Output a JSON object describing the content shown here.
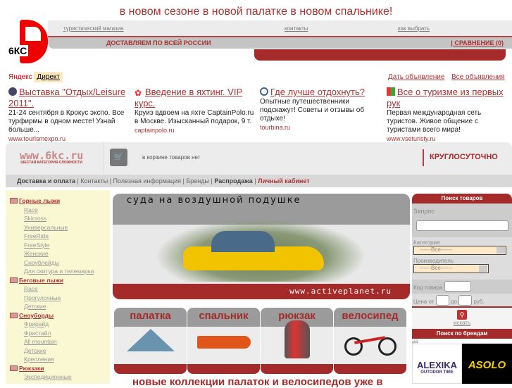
{
  "tagline": "в новом сезоне в новой палатке в новом спальнике!",
  "logo_text": "6КС",
  "topnav": [
    "туристический магазин",
    "контакты",
    "как выбрать"
  ],
  "delivery": "ДОСТАВЛЯЕМ ПО ВСЕЙ РОССИИ",
  "compare": "| СРАВНЕНИЕ (0)",
  "yandex": {
    "brand": "Яндекс",
    "direct": "Директ",
    "give_ad": "Дать объявление",
    "all_ads": "Все объявления"
  },
  "ads": [
    {
      "title": "Выставка \"Отдых/Leisure 2011\".",
      "text": "21-24 сентября в Крокус экспо. Все турфирмы в одном месте! Узнай больше...",
      "url": "www.tourismexpo.ru"
    },
    {
      "title": "Введение в яхтинг. VIP курс.",
      "text": "Круиз вдвоем на яхте CaptainPolo.ru в Москве. Изысканный подарок, 9 т.",
      "url": "captainpolo.ru"
    },
    {
      "title": "Где лучше отдохнуть?",
      "text": "Опытные путешественники подскажут! Советы и отзывы об отдыхе!",
      "url": "tourbina.ru"
    },
    {
      "title": "Все о туризме из первых рук",
      "text": "Первая международная сеть туристов. Живое общение с туристами всего мира!",
      "url": "www.vseturisty.ru"
    }
  ],
  "site_logo": {
    "url": "www.6kc.ru",
    "sub": "ШЕСТАЯ КАТЕГОРИЯ СЛОЖНОСТИ"
  },
  "cart": "в корзине товаров нет",
  "hours": "КРУГЛОСУТОЧНО",
  "subnav": [
    "Доставка и оплата",
    "Контакты",
    "Полезная информация",
    "Бренды",
    "Распродажа",
    "Личный кабинет"
  ],
  "sidebar": [
    {
      "cat": "Горные лыжи",
      "items": [
        "Race",
        "Skicross",
        "Универсальные",
        "FreeRide",
        "FreeStyle",
        "Женские",
        "Сноублейды",
        "Для скитура и телемарка"
      ]
    },
    {
      "cat": "Беговые лыжи",
      "items": [
        "Race",
        "Прогулочные",
        "Детские"
      ]
    },
    {
      "cat": "Сноуборды",
      "items": [
        "Фрирайд",
        "Фристайл",
        "All mountain",
        "Детские",
        "Крепления"
      ]
    },
    {
      "cat": "Рюкзаки",
      "items": [
        "Экспедиционные"
      ]
    }
  ],
  "banner": {
    "title": "суда на воздушной подушке",
    "url": "www.activeplanet.ru"
  },
  "tiles": [
    "палатка",
    "спальник",
    "рюкзак",
    "велосипед"
  ],
  "promo": "новые коллекции палаток и велосипедов уже в",
  "search": {
    "title": "Поиск товаров",
    "query": "Запрос",
    "category": "Категория",
    "all": "------Все------",
    "maker": "Производитель",
    "code": "Код товара",
    "price_from": "Цена от",
    "to": "до",
    "rub": "руб.",
    "go": "искать",
    "brands_title": "Поиск по брендам",
    "hash": "##"
  },
  "brands": [
    "ALEXIKA",
    "OUTODOR TIME",
    "ASOLO"
  ]
}
